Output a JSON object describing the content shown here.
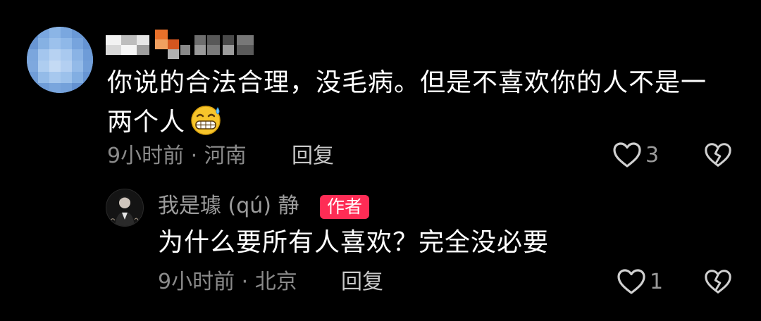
{
  "comments": [
    {
      "username": "",
      "text": "你说的合法合理，没毛病。但是不喜欢你的人不是一两个人",
      "emoji": "grinning-sweat-emoji",
      "time": "9小时前",
      "separator": " · ",
      "location": "河南",
      "reply_label": "回复",
      "likes": "3"
    }
  ],
  "reply": {
    "username": "我是璩 (qú) 静",
    "badge": "作者",
    "text": "为什么要所有人喜欢？完全没必要",
    "time": "9小时前",
    "separator": " · ",
    "location": "北京",
    "reply_label": "回复",
    "likes": "1"
  },
  "colors": {
    "background": "#000000",
    "meta_text": "#8a8a8a",
    "badge": "#fe2c55",
    "icon": "#d0d0d0"
  }
}
